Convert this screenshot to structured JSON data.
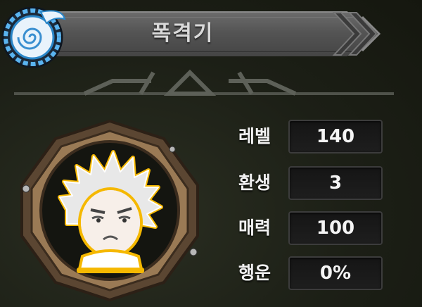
{
  "title": "폭격기",
  "emblem_icon": "spiral-wing-emblem-icon",
  "portrait_icon": "white-spiky-hair-character-portrait",
  "colors": {
    "banner": "#5a5a5a",
    "frame": "#8a6a45",
    "glow": "#f5b800",
    "emblem": "#3aa0e0"
  },
  "stats": [
    {
      "label": "레벨",
      "value": "140"
    },
    {
      "label": "환생",
      "value": "3"
    },
    {
      "label": "매력",
      "value": "100"
    },
    {
      "label": "행운",
      "value": "0%"
    }
  ]
}
